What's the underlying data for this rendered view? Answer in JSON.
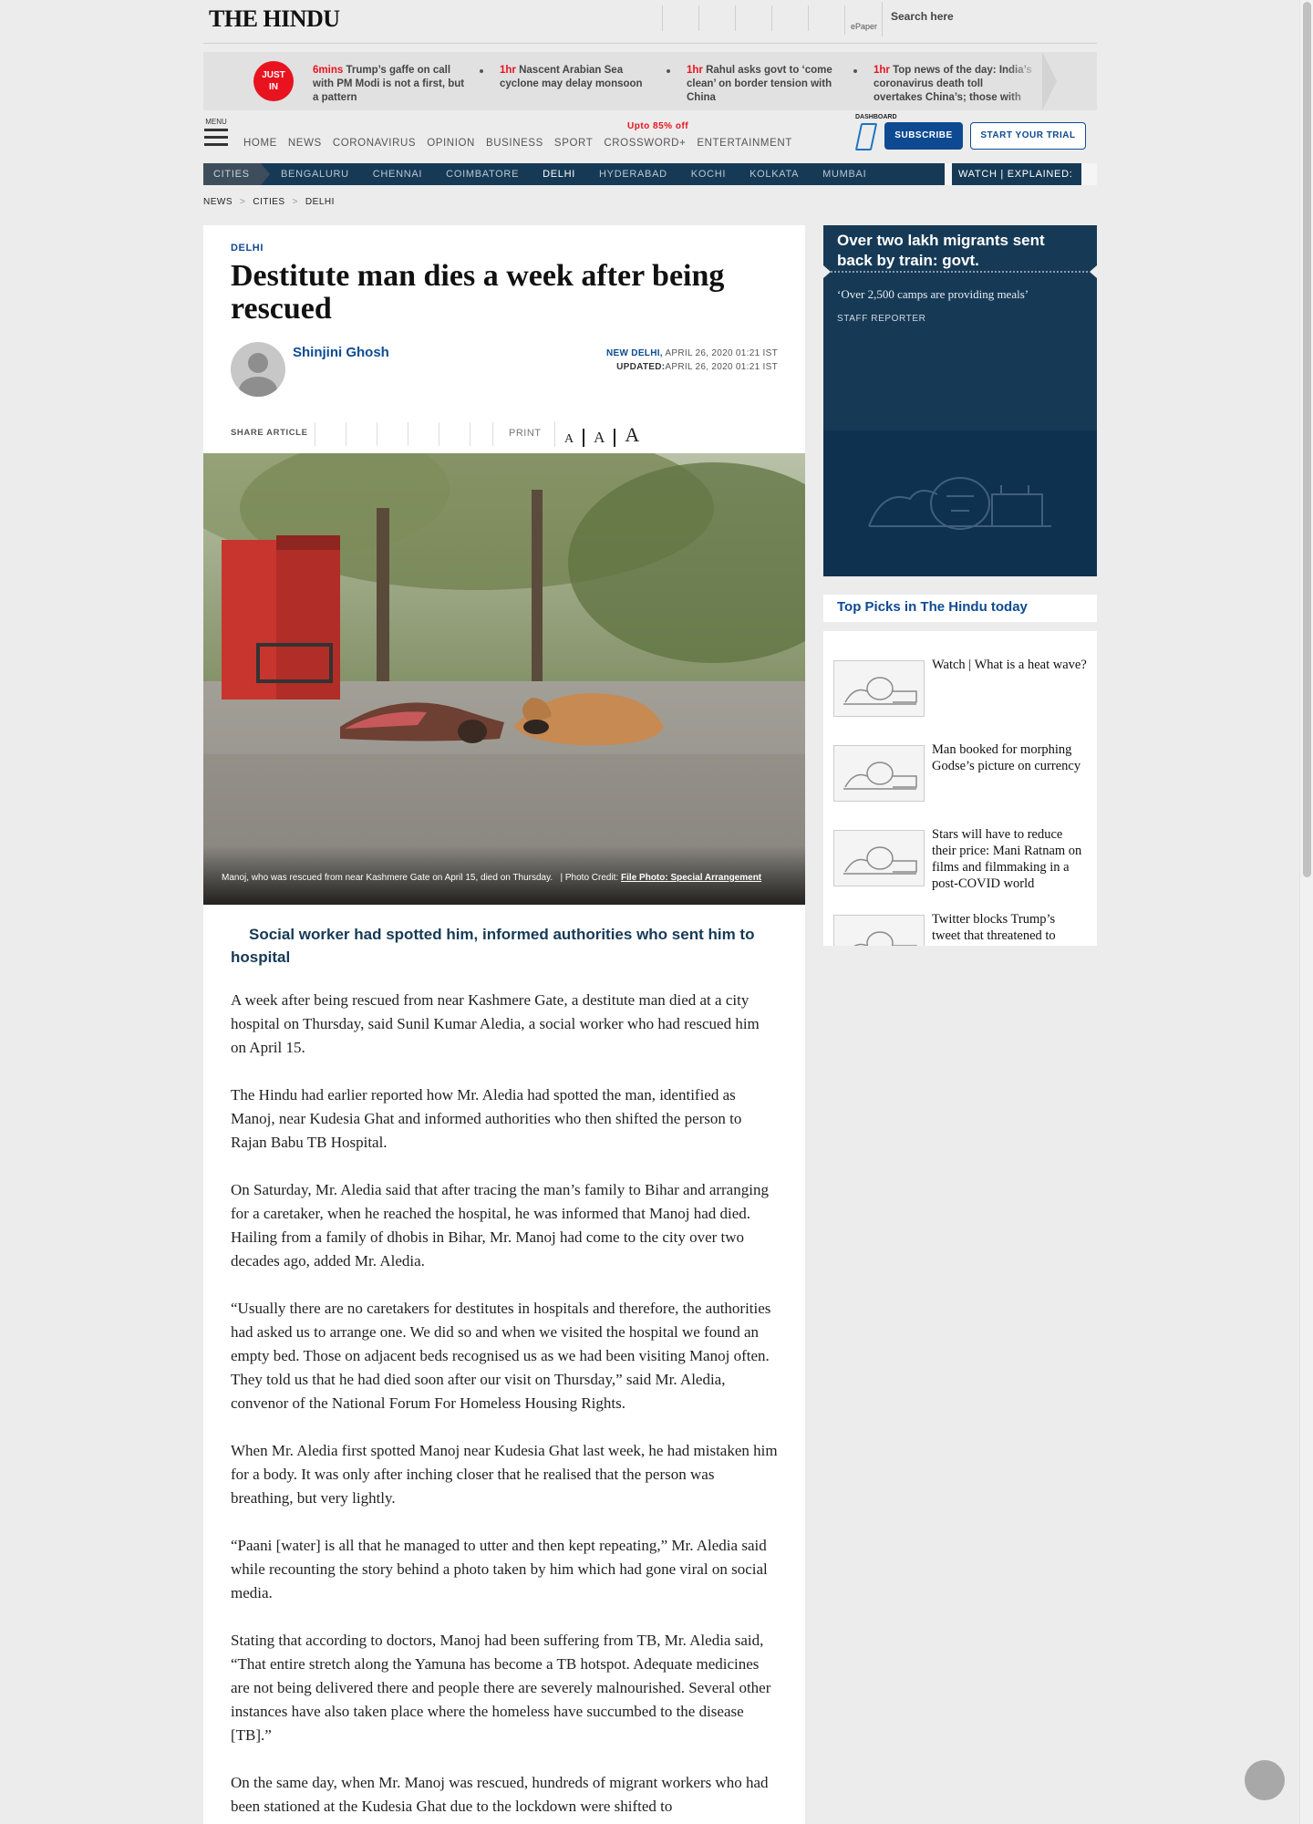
{
  "header": {
    "logo_text": "THE HINDU",
    "epaper_label": "ePaper",
    "search_placeholder": "Search here"
  },
  "just_in": {
    "badge": "JUST IN",
    "items": [
      {
        "time": "6mins",
        "text": "Trump’s gaffe on call with PM Modi is not a first, but a pattern"
      },
      {
        "time": "1hr",
        "text": "Nascent Arabian Sea cyclone may delay monsoon"
      },
      {
        "time": "1hr",
        "text": "Rahul asks govt to ‘come clean’ on border tension with China"
      },
      {
        "time": "1hr",
        "text": "Top news of the day: India’s coronavirus death toll overtakes China’s; those with"
      }
    ]
  },
  "nav": {
    "menu_label": "MENU",
    "items": [
      "HOME",
      "NEWS",
      "CORONAVIRUS",
      "OPINION",
      "BUSINESS",
      "SPORT",
      "CROSSWORD+",
      "ENTERTAINMENT"
    ],
    "crossword_badge": "Upto 85% off",
    "dashboard_label": "DASHBOARD",
    "subscribe_label": "SUBSCRIBE",
    "trial_label": "START YOUR TRIAL"
  },
  "city_bar": {
    "label": "CITIES",
    "cities": [
      "BENGALURU",
      "CHENNAI",
      "COIMBATORE",
      "DELHI",
      "HYDERABAD",
      "KOCHI",
      "KOLKATA",
      "MUMBAI"
    ],
    "active": "DELHI",
    "watch_label": "WATCH",
    "explained_label": "EXPLAINED:"
  },
  "breadcrumb": [
    "NEWS",
    "CITIES",
    "DELHI"
  ],
  "article": {
    "kicker": "DELHI",
    "headline": "Destitute man dies a week after being rescued",
    "author": "Shinjini Ghosh",
    "dateline_place": "NEW DELHI,",
    "dateline_date": "APRIL 26, 2020 01:21 IST",
    "updated_label": "UPDATED:",
    "updated_date": "APRIL 26, 2020 01:21 IST",
    "share_label": "SHARE ARTICLE",
    "print_label": "PRINT",
    "font_sizes": [
      "A",
      "A",
      "A"
    ],
    "caption": "Manoj, who was rescued from near Kashmere Gate on April 15, died on Thursday.",
    "photo_credit_label": "| Photo Credit:",
    "photo_credit": "File Photo: Special Arrangement",
    "deck": "Social worker had spotted him, informed authorities who sent him to hospital",
    "paragraphs": [
      "A week after being rescued from near Kashmere Gate, a destitute man died at a city hospital on Thursday, said Sunil Kumar Aledia, a social worker who had rescued him on April 15.",
      "The Hindu had earlier reported how Mr. Aledia had spotted the man, identified as Manoj, near Kudesia Ghat and informed authorities who then shifted the person to Rajan Babu TB Hospital.",
      "On Saturday, Mr. Aledia said that after tracing the man’s family to Bihar and arranging for a caretaker, when he reached the hospital, he was informed that Manoj had died. Hailing from a family of dhobis in Bihar, Mr. Manoj had come to the city over two decades ago, added Mr. Aledia.",
      "“Usually there are no caretakers for destitutes in hospitals and therefore, the authorities had asked us to arrange one. We did so and when we visited the hospital we found an empty bed. Those on adjacent beds recognised us as we had been visiting Manoj often. They told us that he had died soon after our visit on Thursday,” said Mr. Aledia, convenor of the National Forum For Homeless Housing Rights.",
      "When Mr. Aledia first spotted Manoj near Kudesia Ghat last week, he had mistaken him for a body. It was only after inching closer that he realised that the person was breathing, but very lightly.",
      "“Paani [water] is all that he managed to utter and then kept repeating,” Mr. Aledia said while recounting the story behind a photo taken by him which had gone viral on social media.",
      "Stating that according to doctors, Manoj had been suffering from TB, Mr. Aledia said, “That entire stretch along the Yamuna has become a TB hotspot. Adequate medicines are not being delivered there and people there are severely malnourished. Several other instances have also taken place where the homeless have succumbed to the disease [TB].”",
      "On the same day, when Mr. Manoj was rescued, hundreds of migrant workers who had been stationed at the Kudesia Ghat due to the lockdown were shifted to"
    ]
  },
  "sidebar": {
    "promo_title": "Over two lakh migrants sent back by train: govt.",
    "promo_sub": "‘Over 2,500 camps are providing meals’",
    "promo_reporter": "STAFF REPORTER",
    "top_picks_title": "Top Picks in The Hindu today",
    "top_picks": [
      "Watch | What is a heat wave?",
      "Man booked for morphing Godse’s picture on currency",
      "Stars will have to reduce their price: Mani Ratnam on films and filmmaking in a post-COVID world",
      "Twitter blocks Trump’s tweet that threatened to"
    ]
  },
  "colors": {
    "brand_blue": "#0e4a92",
    "navy": "#163a56",
    "red": "#e8131f"
  }
}
